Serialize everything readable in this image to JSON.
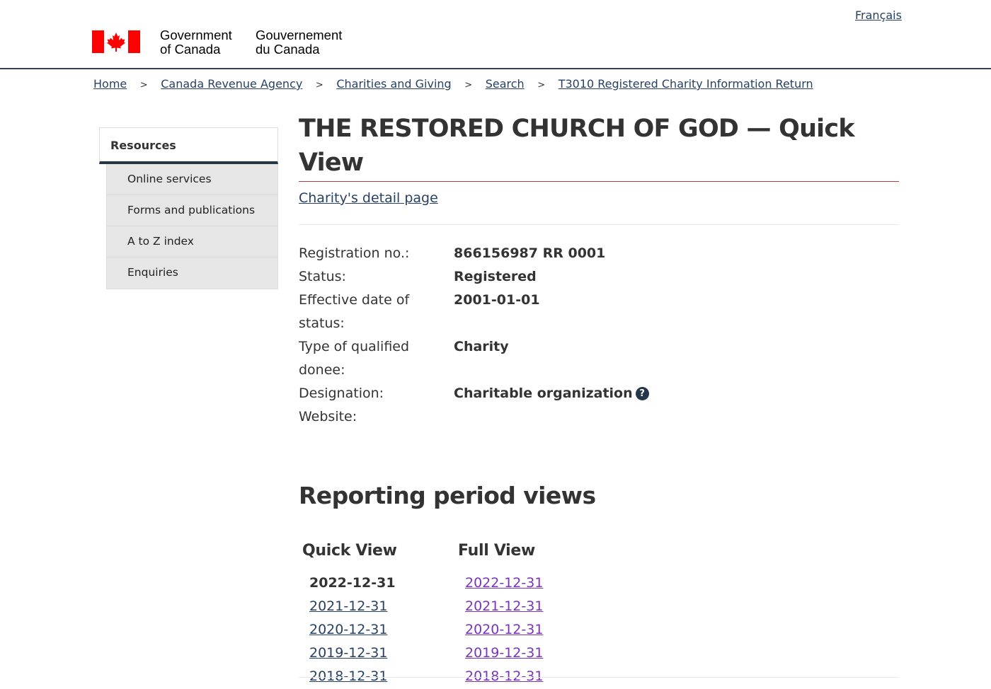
{
  "header": {
    "language_link": "Français",
    "wordmark_en_line1": "Government",
    "wordmark_en_line2": "of Canada",
    "wordmark_fr_line1": "Gouvernement",
    "wordmark_fr_line2": "du Canada",
    "flag_color": "#ff0000"
  },
  "breadcrumb": [
    "Home",
    "Canada Revenue Agency",
    "Charities and Giving",
    "Search",
    "T3010 Registered Charity Information Return"
  ],
  "breadcrumb_separator": ">",
  "sidebar": {
    "heading": "Resources",
    "items": [
      "Online services",
      "Forms and publications",
      "A to Z index",
      "Enquiries"
    ]
  },
  "page": {
    "title": "THE RESTORED CHURCH OF GOD — Quick View",
    "detail_link": "Charity's detail page"
  },
  "info": {
    "registration_label": "Registration no.:",
    "registration_value": "866156987 RR 0001",
    "status_label": "Status:",
    "status_value": "Registered",
    "effective_label": "Effective date of status:",
    "effective_value": "2001-01-01",
    "donee_label": "Type of qualified donee:",
    "donee_value": "Charity",
    "designation_label": "Designation:",
    "designation_value": "Charitable organization",
    "website_label": "Website:",
    "website_value": ""
  },
  "reporting": {
    "heading": "Reporting period views",
    "quick_heading": "Quick View",
    "full_heading": "Full View",
    "quick_current": "2022-12-31",
    "quick_links": [
      "2021-12-31",
      "2020-12-31",
      "2019-12-31",
      "2018-12-31"
    ],
    "full_links": [
      "2022-12-31",
      "2021-12-31",
      "2020-12-31",
      "2019-12-31",
      "2018-12-31"
    ]
  },
  "colors": {
    "link": "#284162",
    "visited_link": "#7834bc",
    "title_rule": "#af3c43",
    "sidebar_accent": "#26374a"
  }
}
